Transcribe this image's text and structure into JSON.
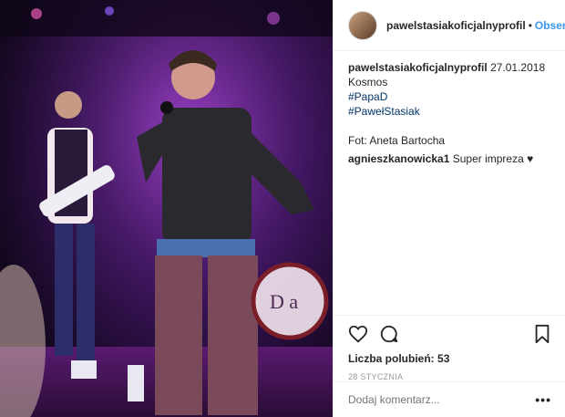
{
  "header": {
    "username": "pawelstasiakoficjalnyprofil",
    "separator": "•",
    "follow_label": "Obser"
  },
  "caption": {
    "username": "pawelstasiakoficjalnyprofil",
    "date": "27.01.2018",
    "text": "Kosmos",
    "hashtags": [
      "#PapaD",
      "#PawełStasiak"
    ],
    "credit": "Fot: Aneta Bartocha"
  },
  "comments": [
    {
      "username": "agnieszkanowicka1",
      "text": "Super impreza ♥"
    }
  ],
  "actions": {
    "like_icon": "heart-icon",
    "comment_icon": "comment-icon",
    "save_icon": "bookmark-icon"
  },
  "likes": {
    "label": "Liczba polubień:",
    "count": "53"
  },
  "post_date": "28 STYCZNIA",
  "add_comment": {
    "placeholder": "Dodaj komentarz...",
    "more_label": "•••"
  },
  "colors": {
    "link": "#3897f0",
    "hashtag": "#003569",
    "muted": "#999999"
  }
}
